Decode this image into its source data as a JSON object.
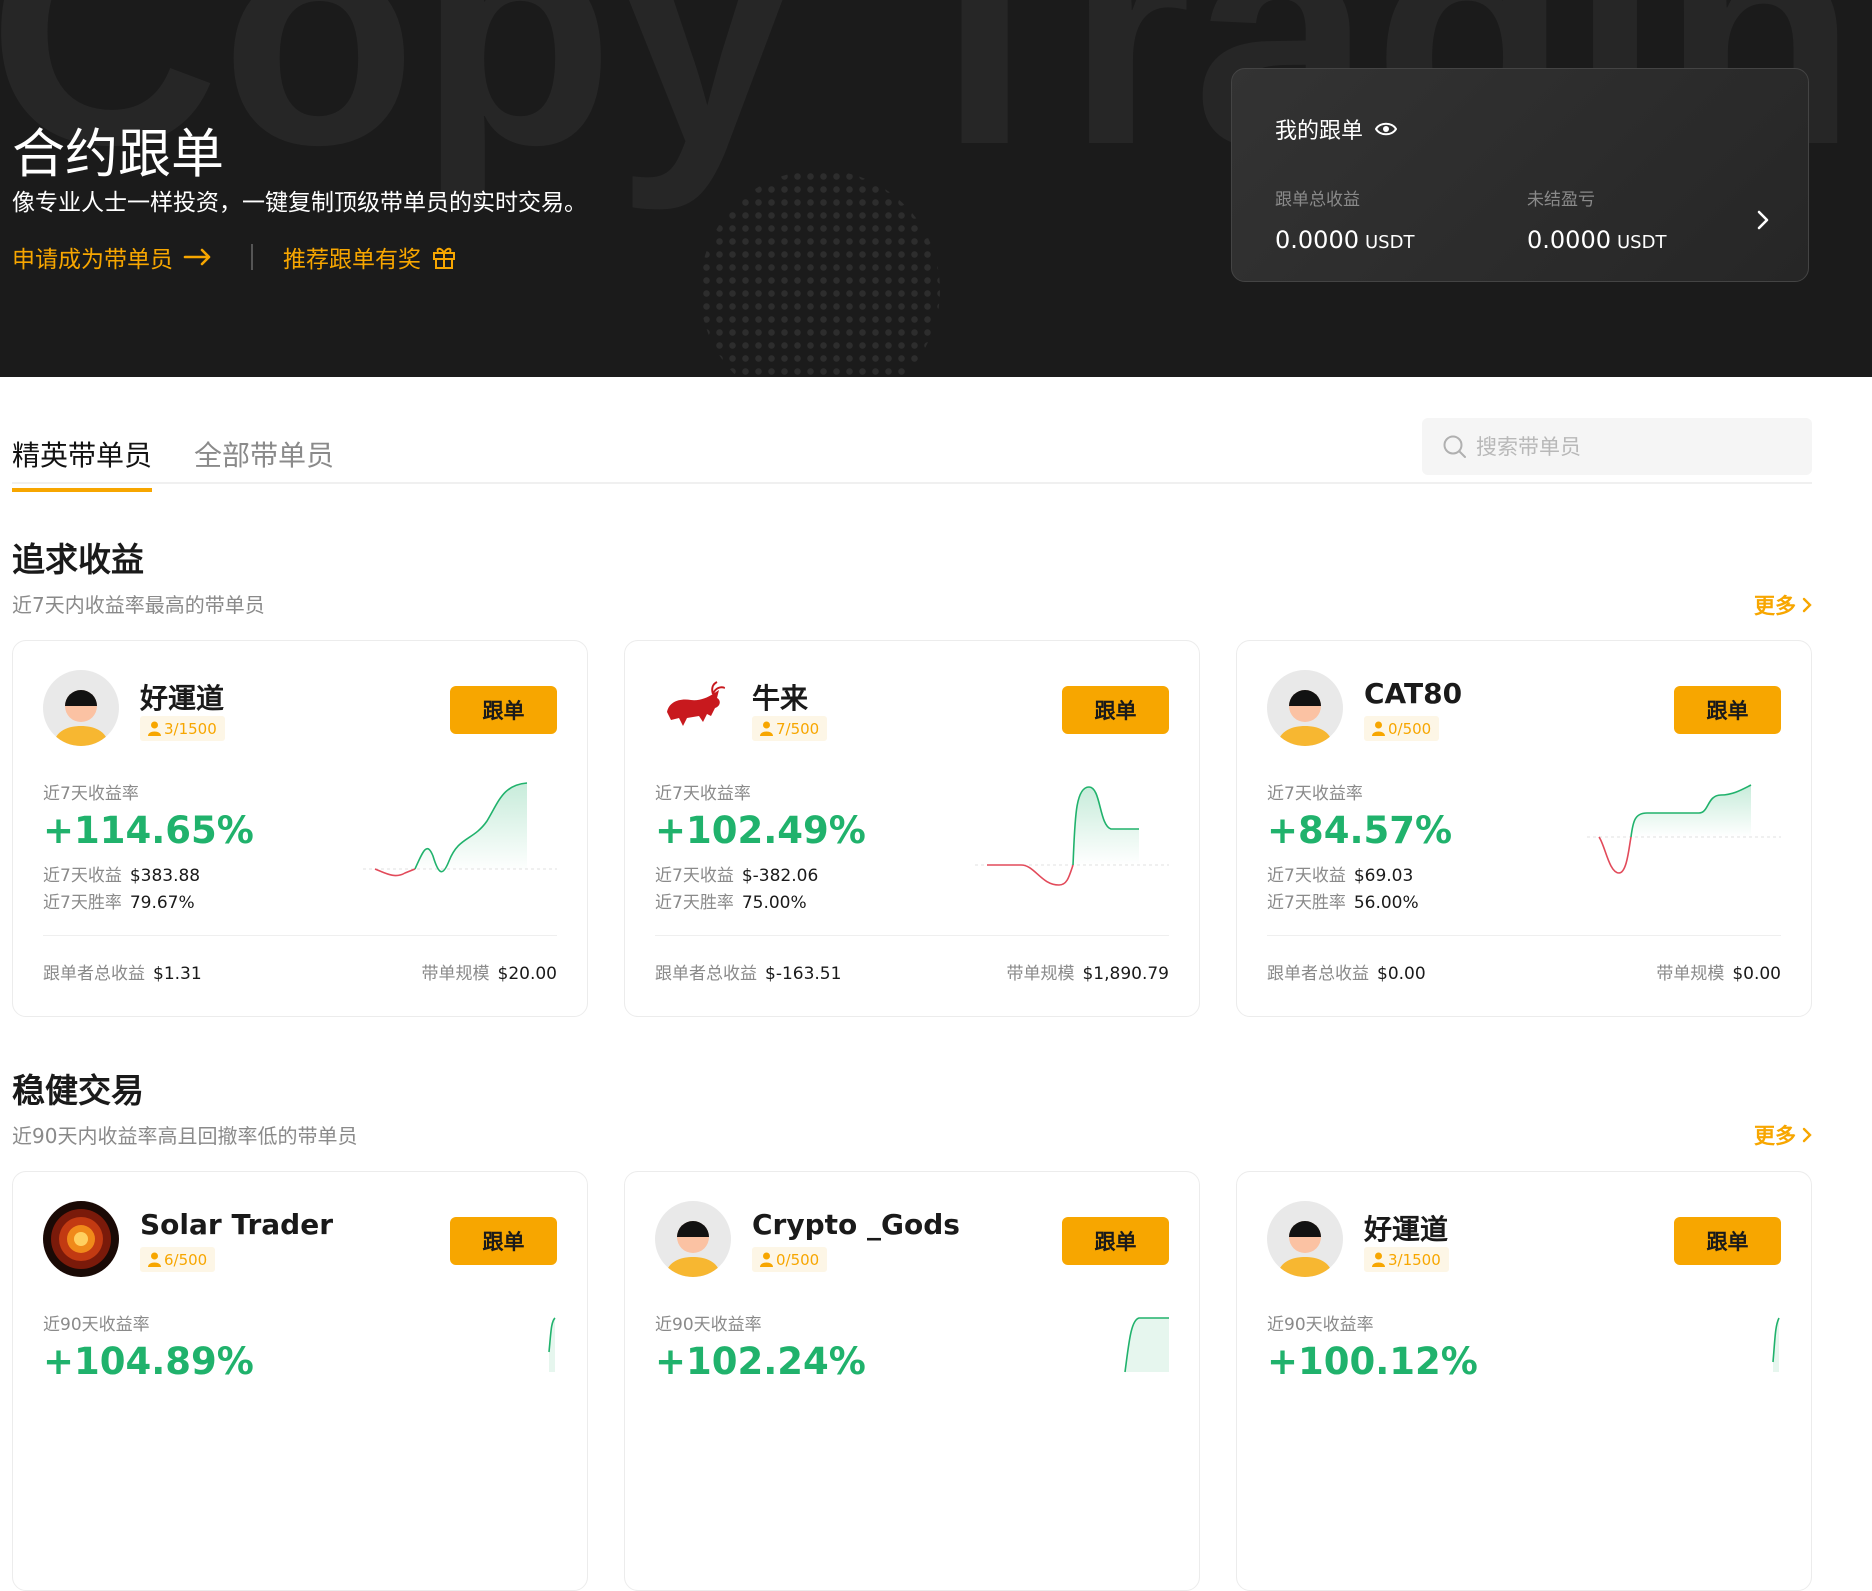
{
  "hero": {
    "watermark": "Copy Trading",
    "title": "合约跟单",
    "subtitle": "像专业人士一样投资，一键复制顶级带单员的实时交易。",
    "apply_link": "申请成为带单员",
    "referral_link": "推荐跟单有奖"
  },
  "my_copy": {
    "title": "我的跟单",
    "total_profit_label": "跟单总收益",
    "total_profit_value": "0.0000",
    "unrealized_label": "未结盈亏",
    "unrealized_value": "0.0000",
    "unit": "USDT"
  },
  "tabs": {
    "elite": "精英带单员",
    "all": "全部带单员"
  },
  "search": {
    "placeholder": "搜索带单员"
  },
  "colors": {
    "accent": "#f7a600",
    "positive": "#20b26c",
    "negative": "#e24a5a"
  },
  "sections": [
    {
      "title": "追求收益",
      "subtitle": "近7天内收益率最高的带单员",
      "more": "更多",
      "cards": [
        {
          "name": "好運道",
          "avatar": "default-avatar",
          "followers": "3/1500",
          "follow_label": "跟单",
          "roi_label": "近7天收益率",
          "roi": "+114.65%",
          "profit_label": "近7天收益",
          "profit": "$383.88",
          "winrate_label": "近7天胜率",
          "winrate": "79.67%",
          "copier_profit_label": "跟单者总收益",
          "copier_profit": "$1.31",
          "aum_label": "带单规模",
          "aum": "$20.00"
        },
        {
          "name": "牛来",
          "avatar": "bull-avatar",
          "followers": "7/500",
          "follow_label": "跟单",
          "roi_label": "近7天收益率",
          "roi": "+102.49%",
          "profit_label": "近7天收益",
          "profit": "$-382.06",
          "winrate_label": "近7天胜率",
          "winrate": "75.00%",
          "copier_profit_label": "跟单者总收益",
          "copier_profit": "$-163.51",
          "aum_label": "带单规模",
          "aum": "$1,890.79"
        },
        {
          "name": "CAT80",
          "avatar": "default-avatar",
          "followers": "0/500",
          "follow_label": "跟单",
          "roi_label": "近7天收益率",
          "roi": "+84.57%",
          "profit_label": "近7天收益",
          "profit": "$69.03",
          "winrate_label": "近7天胜率",
          "winrate": "56.00%",
          "copier_profit_label": "跟单者总收益",
          "copier_profit": "$0.00",
          "aum_label": "带单规模",
          "aum": "$0.00"
        }
      ]
    },
    {
      "title": "稳健交易",
      "subtitle": "近90天内收益率高且回撤率低的带单员",
      "more": "更多",
      "cards": [
        {
          "name": "Solar Trader",
          "avatar": "sun-avatar",
          "followers": "6/500",
          "follow_label": "跟单",
          "roi_label": "近90天收益率",
          "roi": "+104.89%"
        },
        {
          "name": "Crypto _Gods",
          "avatar": "default-avatar",
          "followers": "0/500",
          "follow_label": "跟单",
          "roi_label": "近90天收益率",
          "roi": "+102.24%"
        },
        {
          "name": "好運道",
          "avatar": "default-avatar",
          "followers": "3/1500",
          "follow_label": "跟单",
          "roi_label": "近90天收益率",
          "roi": "+100.12%"
        }
      ]
    }
  ]
}
